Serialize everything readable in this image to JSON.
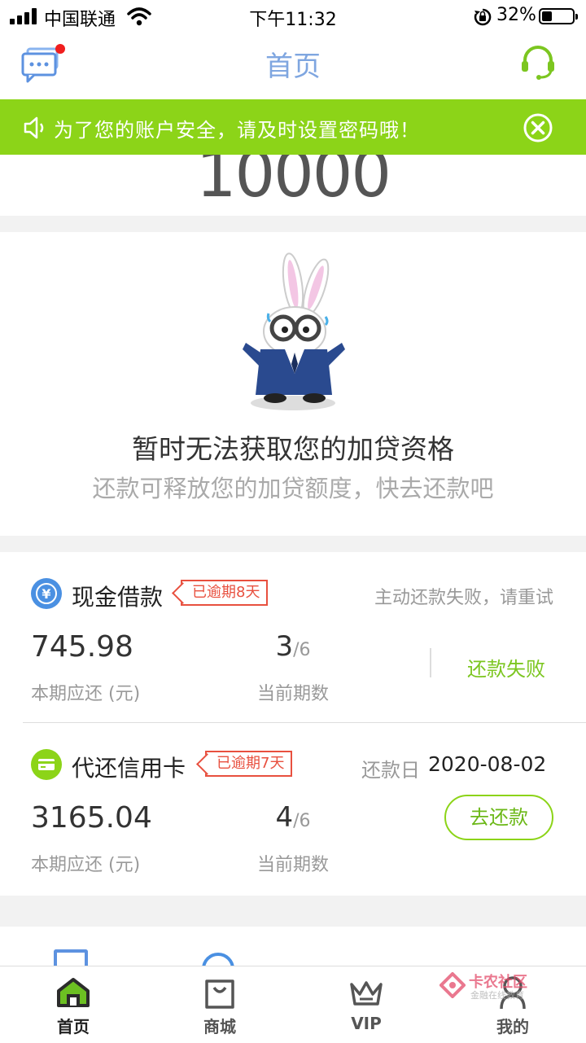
{
  "status_bar": {
    "carrier": "中国联通",
    "time": "下午11:32",
    "battery_pct": "32%",
    "battery_level": 0.32
  },
  "nav": {
    "title": "首页",
    "message_icon": "chat-bubble-icon",
    "service_icon": "headset-icon"
  },
  "banner": {
    "text": "为了您的账户安全，请及时设置密码哦！",
    "icon": "speaker-icon",
    "close_icon": "close-icon"
  },
  "credit": {
    "amount": "10000"
  },
  "empty_state": {
    "title": "暂时无法获取您的加贷资格",
    "subtitle": "还款可释放您的加贷额度，快去还款吧"
  },
  "loans": [
    {
      "name": "现金借款",
      "overdue": "已逾期8天",
      "right_label": "主动还款失败，请重试",
      "amount": "745.98",
      "amount_label": "本期应还 (元)",
      "period_current": "3",
      "period_total": "/6",
      "period_label": "当前期数",
      "action": "还款失败"
    },
    {
      "name": "代还信用卡",
      "overdue": "已逾期7天",
      "due_label": "还款日",
      "due_date": "2020-08-02",
      "amount": "3165.04",
      "amount_label": "本期应还 (元)",
      "period_current": "4",
      "period_total": "/6",
      "period_label": "当前期数",
      "action": "去还款"
    }
  ],
  "tabs": [
    {
      "label": "首页",
      "icon": "home-icon",
      "active": true
    },
    {
      "label": "商城",
      "icon": "shopping-bag-icon",
      "active": false
    },
    {
      "label": "VIP",
      "icon": "crown-icon",
      "active": false
    },
    {
      "label": "我的",
      "icon": "user-icon",
      "active": false
    }
  ],
  "watermark": {
    "brand": "卡农社区",
    "tagline": "金融在线教育"
  },
  "colors": {
    "accent_green": "#8cd418",
    "title_blue": "#7fa6e0",
    "overdue_red": "#e8503f",
    "loan_icon_blue": "#4a90e2"
  }
}
